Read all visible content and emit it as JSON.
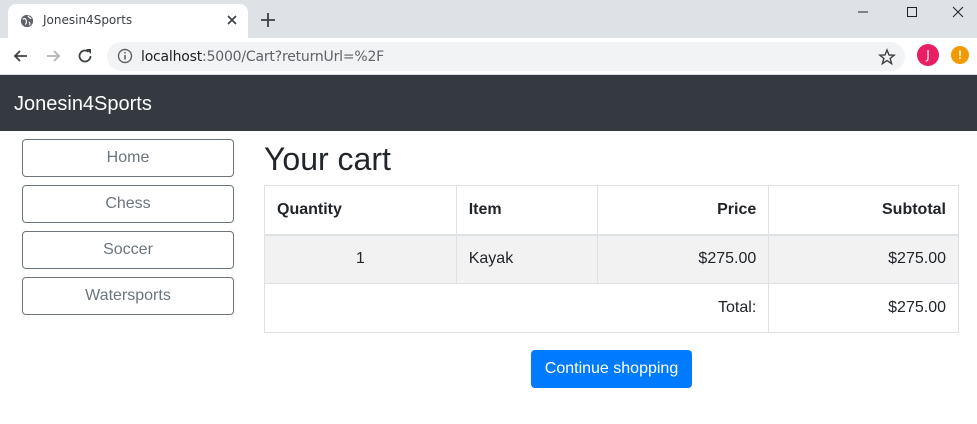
{
  "browser": {
    "tab_title": "Jonesin4Sports",
    "url_host": "localhost",
    "url_rest": ":5000/Cart?returnUrl=%2F",
    "avatar_letter": "J",
    "alert_glyph": "!"
  },
  "navbar": {
    "brand": "Jonesin4Sports",
    "color": "#343a40"
  },
  "sidebar": {
    "categories": [
      {
        "label": "Home"
      },
      {
        "label": "Chess"
      },
      {
        "label": "Soccer"
      },
      {
        "label": "Watersports"
      }
    ]
  },
  "main": {
    "heading": "Your cart",
    "table": {
      "headers": {
        "quantity": "Quantity",
        "item": "Item",
        "price": "Price",
        "subtotal": "Subtotal"
      },
      "rows": [
        {
          "quantity": "1",
          "item": "Kayak",
          "price": "$275.00",
          "subtotal": "$275.00"
        }
      ],
      "footer": {
        "total_label": "Total:",
        "total_value": "$275.00"
      }
    },
    "continue_label": "Continue shopping",
    "accent": "#007bff"
  }
}
